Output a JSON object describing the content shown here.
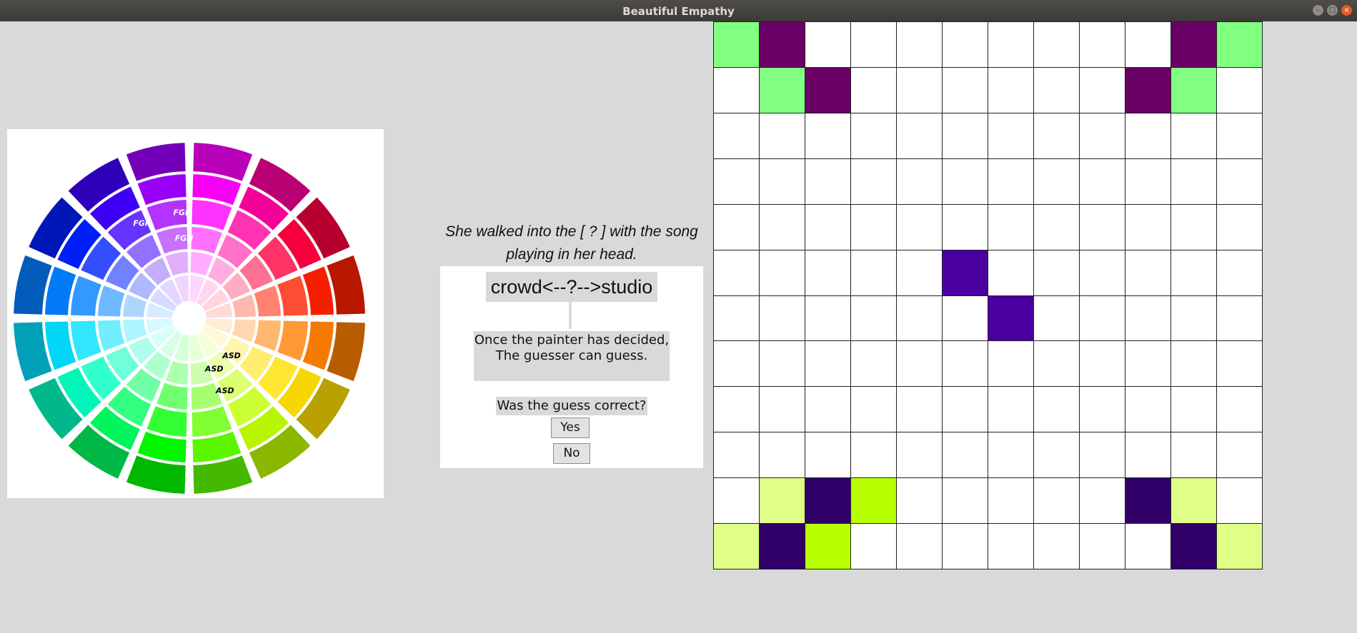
{
  "window": {
    "title": "Beautiful Empathy"
  },
  "wheel": {
    "labels": [
      {
        "text": "FGH",
        "ring": 3,
        "sector": 1
      },
      {
        "text": "FGH",
        "ring": 3,
        "sector": 2
      },
      {
        "text": "FGH",
        "ring": 2,
        "sector": 2
      },
      {
        "text": "ASD",
        "ring": 1,
        "sector": 9
      },
      {
        "text": "ASD",
        "ring": 2,
        "sector": 9
      },
      {
        "text": "ASD",
        "ring": 1,
        "sector": 8
      }
    ]
  },
  "prompt": {
    "sentence": "She walked into the [ ? ] with the song playing in her head."
  },
  "spectrum": {
    "text": "crowd<--?-->studio"
  },
  "status": {
    "text": "Once the painter has decided,\nThe guesser can guess."
  },
  "guess": {
    "question": "Was the guess correct?",
    "yes_label": "Yes",
    "no_label": "No"
  },
  "board": {
    "rows": 12,
    "cols": 12,
    "cells": [
      {
        "r": 0,
        "c": 0,
        "color": "#80ff80"
      },
      {
        "r": 0,
        "c": 1,
        "color": "#6a0066"
      },
      {
        "r": 0,
        "c": 10,
        "color": "#6a0066"
      },
      {
        "r": 0,
        "c": 11,
        "color": "#80ff80"
      },
      {
        "r": 1,
        "c": 1,
        "color": "#80ff80"
      },
      {
        "r": 1,
        "c": 2,
        "color": "#6a0066"
      },
      {
        "r": 1,
        "c": 9,
        "color": "#6a0066"
      },
      {
        "r": 1,
        "c": 10,
        "color": "#80ff80"
      },
      {
        "r": 5,
        "c": 5,
        "color": "#4a00a0"
      },
      {
        "r": 6,
        "c": 6,
        "color": "#4a00a0"
      },
      {
        "r": 10,
        "c": 1,
        "color": "#e0ff88"
      },
      {
        "r": 10,
        "c": 2,
        "color": "#300068"
      },
      {
        "r": 10,
        "c": 3,
        "color": "#b8ff00"
      },
      {
        "r": 10,
        "c": 9,
        "color": "#300068"
      },
      {
        "r": 10,
        "c": 10,
        "color": "#e0ff88"
      },
      {
        "r": 11,
        "c": 0,
        "color": "#e0ff88"
      },
      {
        "r": 11,
        "c": 1,
        "color": "#300068"
      },
      {
        "r": 11,
        "c": 2,
        "color": "#b8ff00"
      },
      {
        "r": 11,
        "c": 10,
        "color": "#300068"
      },
      {
        "r": 11,
        "c": 11,
        "color": "#e0ff88"
      }
    ]
  }
}
